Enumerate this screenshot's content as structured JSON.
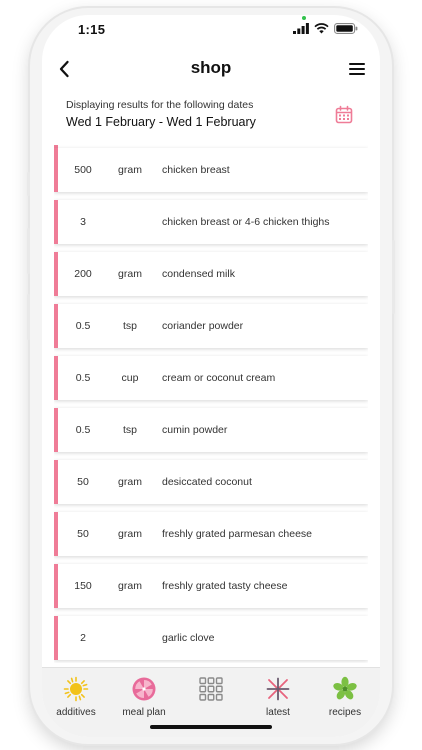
{
  "status": {
    "time": "1:15"
  },
  "header": {
    "title": "shop",
    "back_icon": "chevron-left-icon",
    "menu_icon": "hamburger-menu-icon"
  },
  "dates": {
    "caption": "Displaying results for the following dates",
    "range": "Wed 1 February - Wed 1 February",
    "calendar_icon": "calendar-icon"
  },
  "items": [
    {
      "qty": "500",
      "unit": "gram",
      "name": "chicken breast"
    },
    {
      "qty": "3",
      "unit": "",
      "name": "chicken breast or 4-6 chicken thighs"
    },
    {
      "qty": "200",
      "unit": "gram",
      "name": "condensed milk"
    },
    {
      "qty": "0.5",
      "unit": "tsp",
      "name": "coriander powder"
    },
    {
      "qty": "0.5",
      "unit": "cup",
      "name": "cream or coconut cream"
    },
    {
      "qty": "0.5",
      "unit": "tsp",
      "name": "cumin powder"
    },
    {
      "qty": "50",
      "unit": "gram",
      "name": "desiccated coconut"
    },
    {
      "qty": "50",
      "unit": "gram",
      "name": "freshly grated parmesan cheese"
    },
    {
      "qty": "150",
      "unit": "gram",
      "name": "freshly grated tasty cheese"
    },
    {
      "qty": "2",
      "unit": "",
      "name": "garlic clove"
    }
  ],
  "nav": {
    "additives": "additives",
    "meal_plan": "meal plan",
    "grid": "",
    "latest": "latest",
    "recipes": "recipes"
  },
  "colors": {
    "accent": "#ef7c97",
    "calendar": "#ef7c97"
  }
}
